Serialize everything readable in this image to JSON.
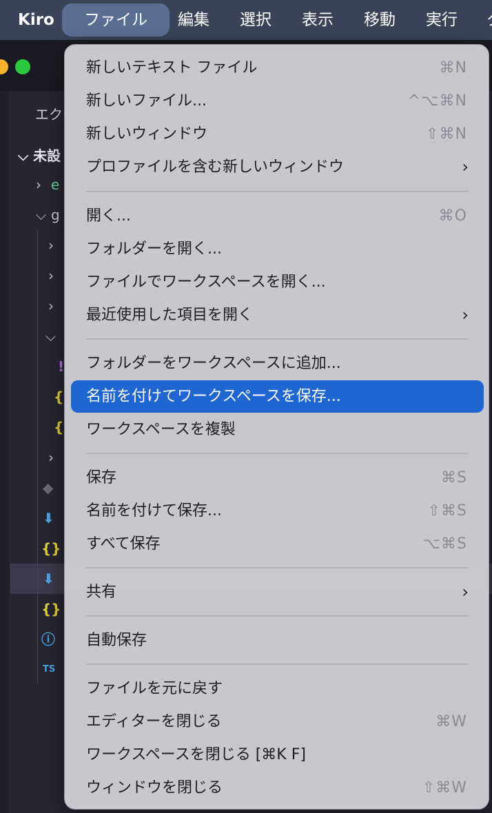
{
  "menubar": {
    "app_name": "Kiro",
    "items": [
      "ファイル",
      "編集",
      "選択",
      "表示",
      "移動",
      "実行",
      "タ"
    ]
  },
  "window": {
    "explorer_title": "エク",
    "section_head": "未設",
    "tree": [
      "e",
      "g"
    ]
  },
  "file_menu": {
    "items": [
      {
        "label": "新しいテキスト ファイル",
        "shortcut": "⌘N"
      },
      {
        "label": "新しいファイル...",
        "shortcut": "^⌥⌘N"
      },
      {
        "label": "新しいウィンドウ",
        "shortcut": "⇧⌘N"
      },
      {
        "label": "プロファイルを含む新しいウィンドウ",
        "shortcut": ""
      },
      {
        "label": "開く...",
        "shortcut": "⌘O"
      },
      {
        "label": "フォルダーを開く...",
        "shortcut": ""
      },
      {
        "label": "ファイルでワークスペースを開く...",
        "shortcut": ""
      },
      {
        "label": "最近使用した項目を開く",
        "shortcut": ""
      },
      {
        "label": "フォルダーをワークスペースに追加...",
        "shortcut": ""
      },
      {
        "label": "名前を付けてワークスペースを保存...",
        "shortcut": ""
      },
      {
        "label": "ワークスペースを複製",
        "shortcut": ""
      },
      {
        "label": "保存",
        "shortcut": "⌘S"
      },
      {
        "label": "名前を付けて保存...",
        "shortcut": "⇧⌘S"
      },
      {
        "label": "すべて保存",
        "shortcut": "⌥⌘S"
      },
      {
        "label": "共有",
        "shortcut": ""
      },
      {
        "label": "自動保存",
        "shortcut": ""
      },
      {
        "label": "ファイルを元に戻す",
        "shortcut": ""
      },
      {
        "label": "エディターを閉じる",
        "shortcut": "⌘W"
      },
      {
        "label": "ワークスペースを閉じる [⌘K F]",
        "shortcut": ""
      },
      {
        "label": "ウィンドウを閉じる",
        "shortcut": "⇧⌘W"
      }
    ]
  },
  "colors": {
    "highlight": "#1f66d1",
    "menubar": "#3a4358",
    "menu_bg": "#cecdd4"
  }
}
